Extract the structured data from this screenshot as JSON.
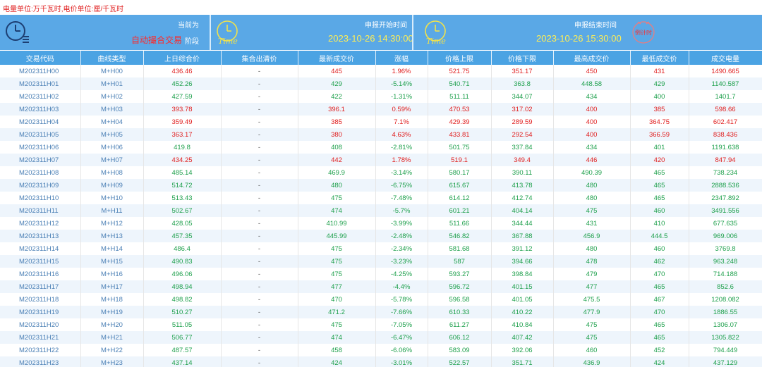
{
  "unit_note": "电量单位:万千瓦时,电价单位:厘/千瓦时",
  "banner": {
    "current_label": "当前为",
    "current_value": "自动撮合交易",
    "phase_label": "阶段",
    "start_label": "申报开始时间",
    "start_value": "2023-10-26 14:30:00",
    "end_label": "申报结束时间",
    "end_value": "2023-10-26 15:30:00",
    "time_icon_text": "Time",
    "countdown_text": "倒计时",
    "colors": {
      "banner": "#5aa8e6",
      "yellow": "#ffee55",
      "red": "#ff2828"
    }
  },
  "table": {
    "headers": [
      "交易代码",
      "曲线类型",
      "上日综合价",
      "集合出清价",
      "最新成交价",
      "涨幅",
      "价格上限",
      "价格下限",
      "最高成交价",
      "最低成交价",
      "成交电量"
    ],
    "rows": [
      {
        "code": "M202311H00",
        "curve": "M+H00",
        "prev": "436.46",
        "clear": "-",
        "latest": "445",
        "change": "1.96%",
        "upper": "521.75",
        "lower": "351.17",
        "high": "450",
        "low": "431",
        "volume": "1490.665",
        "dir": "up"
      },
      {
        "code": "M202311H01",
        "curve": "M+H01",
        "prev": "452.26",
        "clear": "-",
        "latest": "429",
        "change": "-5.14%",
        "upper": "540.71",
        "lower": "363.8",
        "high": "448.58",
        "low": "429",
        "volume": "1140.587",
        "dir": "dn"
      },
      {
        "code": "M202311H02",
        "curve": "M+H02",
        "prev": "427.59",
        "clear": "-",
        "latest": "422",
        "change": "-1.31%",
        "upper": "511.11",
        "lower": "344.07",
        "high": "434",
        "low": "400",
        "volume": "1401.7",
        "dir": "dn"
      },
      {
        "code": "M202311H03",
        "curve": "M+H03",
        "prev": "393.78",
        "clear": "-",
        "latest": "396.1",
        "change": "0.59%",
        "upper": "470.53",
        "lower": "317.02",
        "high": "400",
        "low": "385",
        "volume": "598.66",
        "dir": "up"
      },
      {
        "code": "M202311H04",
        "curve": "M+H04",
        "prev": "359.49",
        "clear": "-",
        "latest": "385",
        "change": "7.1%",
        "upper": "429.39",
        "lower": "289.59",
        "high": "400",
        "low": "364.75",
        "volume": "602.417",
        "dir": "up"
      },
      {
        "code": "M202311H05",
        "curve": "M+H05",
        "prev": "363.17",
        "clear": "-",
        "latest": "380",
        "change": "4.63%",
        "upper": "433.81",
        "lower": "292.54",
        "high": "400",
        "low": "366.59",
        "volume": "838.436",
        "dir": "up"
      },
      {
        "code": "M202311H06",
        "curve": "M+H06",
        "prev": "419.8",
        "clear": "-",
        "latest": "408",
        "change": "-2.81%",
        "upper": "501.75",
        "lower": "337.84",
        "high": "434",
        "low": "401",
        "volume": "1191.638",
        "dir": "dn"
      },
      {
        "code": "M202311H07",
        "curve": "M+H07",
        "prev": "434.25",
        "clear": "-",
        "latest": "442",
        "change": "1.78%",
        "upper": "519.1",
        "lower": "349.4",
        "high": "446",
        "low": "420",
        "volume": "847.94",
        "dir": "up"
      },
      {
        "code": "M202311H08",
        "curve": "M+H08",
        "prev": "485.14",
        "clear": "-",
        "latest": "469.9",
        "change": "-3.14%",
        "upper": "580.17",
        "lower": "390.11",
        "high": "490.39",
        "low": "465",
        "volume": "738.234",
        "dir": "dn"
      },
      {
        "code": "M202311H09",
        "curve": "M+H09",
        "prev": "514.72",
        "clear": "-",
        "latest": "480",
        "change": "-6.75%",
        "upper": "615.67",
        "lower": "413.78",
        "high": "480",
        "low": "465",
        "volume": "2888.536",
        "dir": "dn"
      },
      {
        "code": "M202311H10",
        "curve": "M+H10",
        "prev": "513.43",
        "clear": "-",
        "latest": "475",
        "change": "-7.48%",
        "upper": "614.12",
        "lower": "412.74",
        "high": "480",
        "low": "465",
        "volume": "2347.892",
        "dir": "dn"
      },
      {
        "code": "M202311H11",
        "curve": "M+H11",
        "prev": "502.67",
        "clear": "-",
        "latest": "474",
        "change": "-5.7%",
        "upper": "601.21",
        "lower": "404.14",
        "high": "475",
        "low": "460",
        "volume": "3491.556",
        "dir": "dn"
      },
      {
        "code": "M202311H12",
        "curve": "M+H12",
        "prev": "428.05",
        "clear": "-",
        "latest": "410.99",
        "change": "-3.99%",
        "upper": "511.66",
        "lower": "344.44",
        "high": "431",
        "low": "410",
        "volume": "677.635",
        "dir": "dn"
      },
      {
        "code": "M202311H13",
        "curve": "M+H13",
        "prev": "457.35",
        "clear": "-",
        "latest": "445.99",
        "change": "-2.48%",
        "upper": "546.82",
        "lower": "367.88",
        "high": "456.9",
        "low": "444.5",
        "volume": "969.006",
        "dir": "dn"
      },
      {
        "code": "M202311H14",
        "curve": "M+H14",
        "prev": "486.4",
        "clear": "-",
        "latest": "475",
        "change": "-2.34%",
        "upper": "581.68",
        "lower": "391.12",
        "high": "480",
        "low": "460",
        "volume": "3769.8",
        "dir": "dn"
      },
      {
        "code": "M202311H15",
        "curve": "M+H15",
        "prev": "490.83",
        "clear": "-",
        "latest": "475",
        "change": "-3.23%",
        "upper": "587",
        "lower": "394.66",
        "high": "478",
        "low": "462",
        "volume": "963.248",
        "dir": "dn"
      },
      {
        "code": "M202311H16",
        "curve": "M+H16",
        "prev": "496.06",
        "clear": "-",
        "latest": "475",
        "change": "-4.25%",
        "upper": "593.27",
        "lower": "398.84",
        "high": "479",
        "low": "470",
        "volume": "714.188",
        "dir": "dn"
      },
      {
        "code": "M202311H17",
        "curve": "M+H17",
        "prev": "498.94",
        "clear": "-",
        "latest": "477",
        "change": "-4.4%",
        "upper": "596.72",
        "lower": "401.15",
        "high": "477",
        "low": "465",
        "volume": "852.6",
        "dir": "dn"
      },
      {
        "code": "M202311H18",
        "curve": "M+H18",
        "prev": "498.82",
        "clear": "-",
        "latest": "470",
        "change": "-5.78%",
        "upper": "596.58",
        "lower": "401.05",
        "high": "475.5",
        "low": "467",
        "volume": "1208.082",
        "dir": "dn"
      },
      {
        "code": "M202311H19",
        "curve": "M+H19",
        "prev": "510.27",
        "clear": "-",
        "latest": "471.2",
        "change": "-7.66%",
        "upper": "610.33",
        "lower": "410.22",
        "high": "477.9",
        "low": "470",
        "volume": "1886.55",
        "dir": "dn"
      },
      {
        "code": "M202311H20",
        "curve": "M+H20",
        "prev": "511.05",
        "clear": "-",
        "latest": "475",
        "change": "-7.05%",
        "upper": "611.27",
        "lower": "410.84",
        "high": "475",
        "low": "465",
        "volume": "1306.07",
        "dir": "dn"
      },
      {
        "code": "M202311H21",
        "curve": "M+H21",
        "prev": "506.77",
        "clear": "-",
        "latest": "474",
        "change": "-6.47%",
        "upper": "606.12",
        "lower": "407.42",
        "high": "475",
        "low": "465",
        "volume": "1305.822",
        "dir": "dn"
      },
      {
        "code": "M202311H22",
        "curve": "M+H22",
        "prev": "487.57",
        "clear": "-",
        "latest": "458",
        "change": "-6.06%",
        "upper": "583.09",
        "lower": "392.06",
        "high": "460",
        "low": "452",
        "volume": "794.449",
        "dir": "dn"
      },
      {
        "code": "M202311H23",
        "curve": "M+H23",
        "prev": "437.14",
        "clear": "-",
        "latest": "424",
        "change": "-3.01%",
        "upper": "522.57",
        "lower": "351.71",
        "high": "436.9",
        "low": "424",
        "volume": "437.129",
        "dir": "dn"
      }
    ]
  }
}
